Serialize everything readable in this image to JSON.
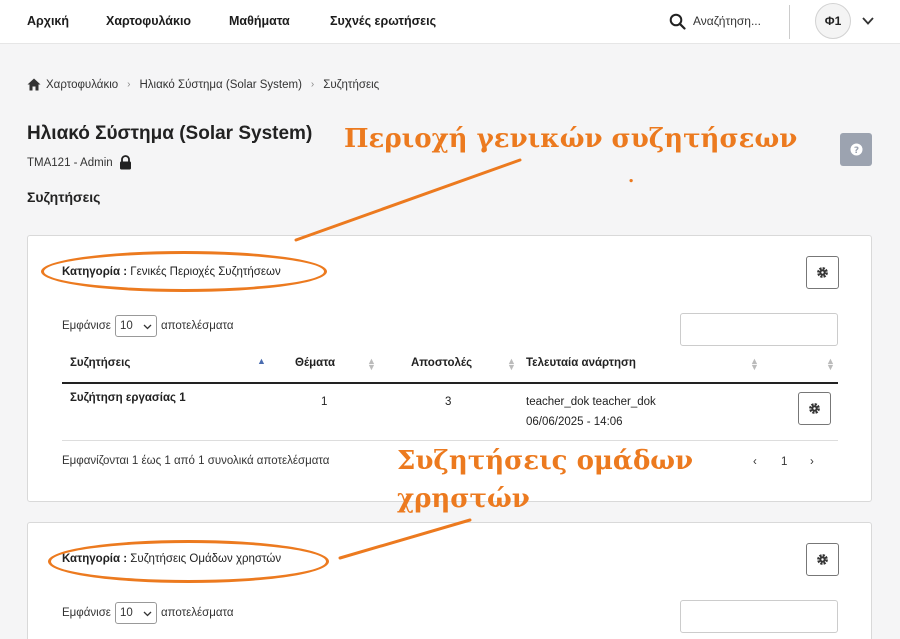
{
  "nav": {
    "items": [
      "Αρχική",
      "Χαρτοφυλάκιο",
      "Μαθήματα",
      "Συχνές ερωτήσεις"
    ],
    "search_placeholder": "Αναζήτηση...",
    "avatar_initials": "Φ1"
  },
  "breadcrumb": [
    "Χαρτοφυλάκιο",
    "Ηλιακό Σύστημα (Solar System)",
    "Συζητήσεις"
  ],
  "page": {
    "title": "Ηλιακό Σύστημα (Solar System)",
    "subtitle": "TMA121 - Admin",
    "section_heading": "Συζητήσεις"
  },
  "annotations": {
    "general": "Περιοχή γενικών συζητήσεων",
    "dot": ".",
    "groups_line1": "Συζητήσεις ομάδων",
    "groups_line2": "χρηστών"
  },
  "cards": [
    {
      "category_label": "Κατηγορία :",
      "category_name": "Γενικές Περιοχές Συζητήσεων",
      "show_prefix": "Εμφάνισε",
      "page_size": "10",
      "show_suffix": "αποτελέσματα",
      "columns": [
        "Συζητήσεις",
        "Θέματα",
        "Αποστολές",
        "Τελευταία ανάρτηση"
      ],
      "rows": [
        {
          "name": "Συζήτηση εργασίας 1",
          "topics": "1",
          "posts": "3",
          "last_author": "teacher_dok teacher_dok",
          "last_date": "06/06/2025 - 14:06"
        }
      ],
      "info": "Εμφανίζονται 1 έως 1 από 1 συνολικά αποτελέσματα",
      "pager": {
        "prev": "‹",
        "current": "1",
        "next": "›"
      }
    },
    {
      "category_label": "Κατηγορία :",
      "category_name": "Συζητήσεις Ομάδων χρηστών",
      "show_prefix": "Εμφάνισε",
      "page_size": "10",
      "show_suffix": "αποτελέσματα"
    }
  ],
  "colors": {
    "accent": "#ec7a1f",
    "help_button": "#9ca3b0"
  }
}
